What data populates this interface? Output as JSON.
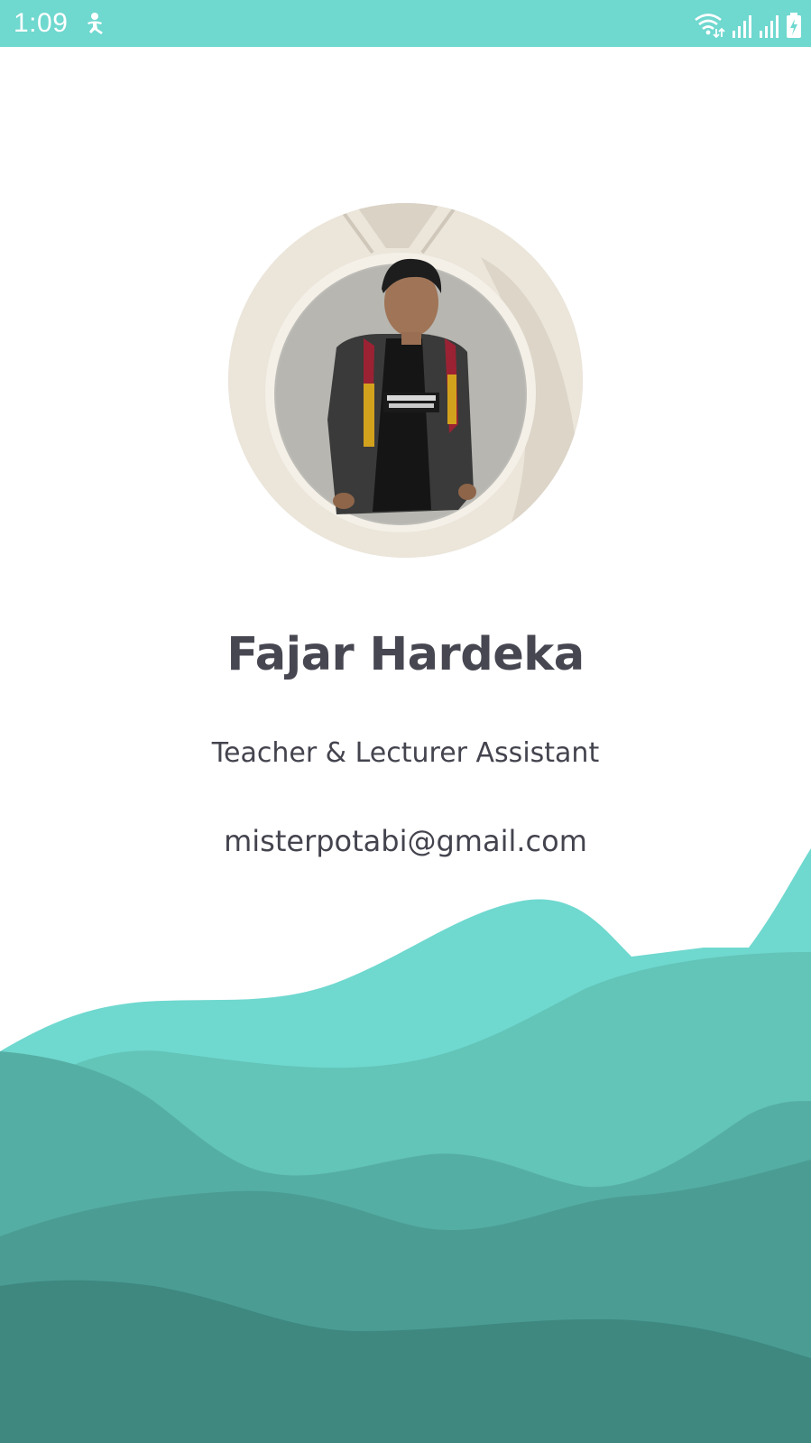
{
  "status_bar": {
    "time": "1:09",
    "notification_icon": "accessibility-icon",
    "right_icons": [
      "wifi-icon",
      "signal-icon",
      "signal-icon",
      "battery-charging-icon"
    ],
    "background_color": "#6fd8cf"
  },
  "profile": {
    "photo": "profile-photo",
    "name": "Fajar Hardeka",
    "role": "Teacher & Lecturer Assistant",
    "email": "misterpotabi@gmail.com"
  },
  "colors": {
    "text_primary": "#474752",
    "wave_1": "#6fd8cf",
    "wave_2": "#63c4b8",
    "wave_3": "#55aea4",
    "wave_4": "#4b9d94",
    "wave_5": "#3e8880"
  }
}
